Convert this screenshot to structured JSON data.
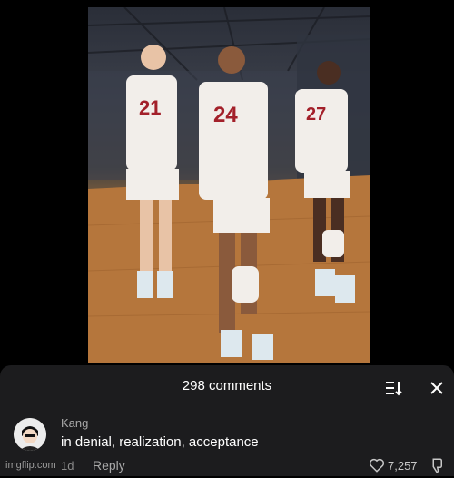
{
  "comments_sheet": {
    "title": "298 comments",
    "sort_icon": "sort-icon",
    "close_icon": "close-icon"
  },
  "comment": {
    "author": "Kang",
    "text": "in denial, realization, acceptance",
    "age": "1d",
    "reply_label": "Reply",
    "like_count": "7,257",
    "like_icon": "heart-icon",
    "dislike_icon": "thumbs-down-icon"
  },
  "watermark": "imgflip.com",
  "jersey_numbers": [
    "21",
    "24",
    "27"
  ],
  "colors": {
    "sheet_bg": "#1c1c1e",
    "jersey_number": "#a3202a"
  }
}
